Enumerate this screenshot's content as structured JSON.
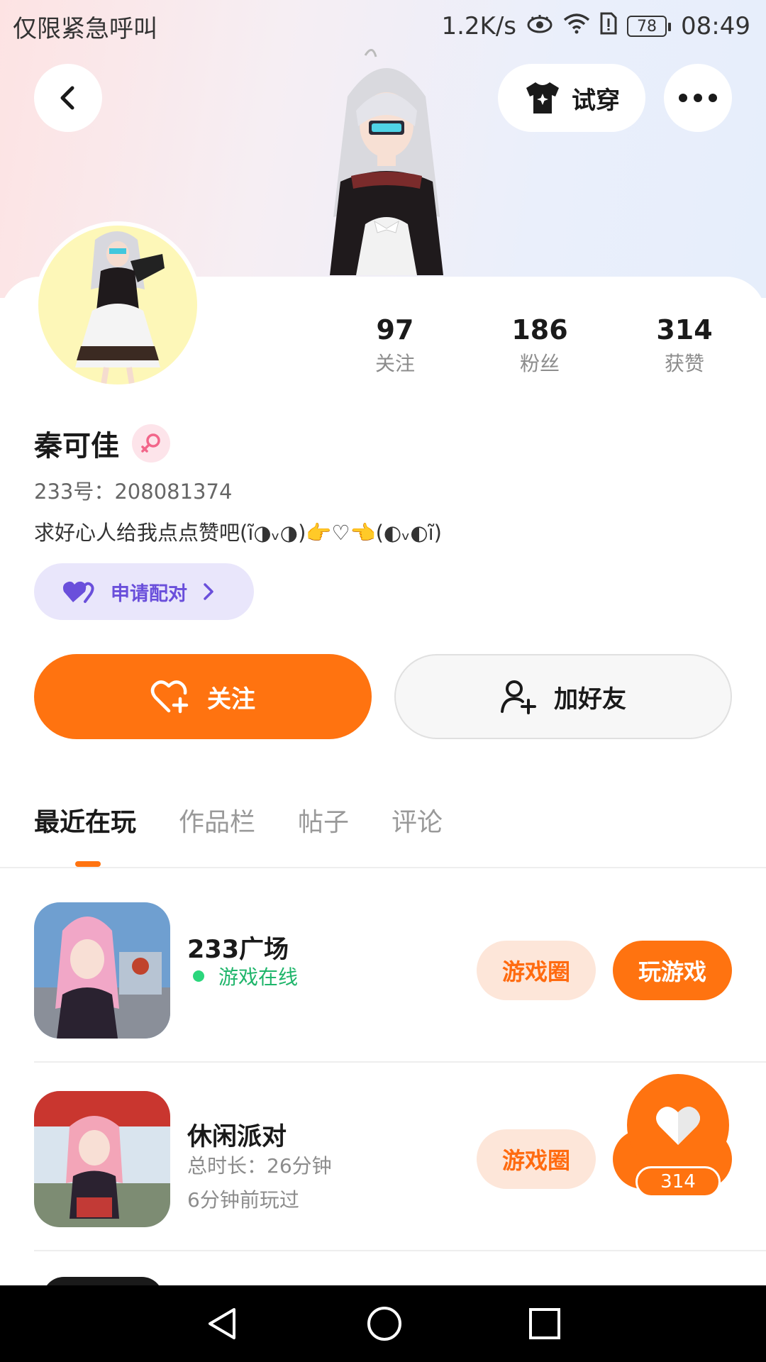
{
  "status_bar": {
    "carrier": "仅限紧急呼叫",
    "speed": "1.2K/s",
    "battery": "78",
    "time": "08:49"
  },
  "header": {
    "tryon_label": "试穿"
  },
  "stats": [
    {
      "value": "97",
      "label": "关注"
    },
    {
      "value": "186",
      "label": "粉丝"
    },
    {
      "value": "314",
      "label": "获赞"
    }
  ],
  "profile": {
    "name": "秦可佳",
    "uid": "233号：208081374",
    "bio": "求好心人给我点点赞吧(ĩ◑ᵥ◑)👉♡👈(◐ᵥ◐ĩ)",
    "pair_label": "申请配对"
  },
  "actions": {
    "follow_label": "关注",
    "add_friend_label": "加好友"
  },
  "tabs": [
    "最近在玩",
    "作品栏",
    "帖子",
    "评论"
  ],
  "games": [
    {
      "title": "233广场",
      "status": "游戏在线",
      "circle_label": "游戏圈",
      "play_label": "玩游戏"
    },
    {
      "title": "休闲派对",
      "duration": "总时长：26分钟",
      "last_played": "6分钟前玩过",
      "circle_label": "游戏圈"
    }
  ],
  "like_fab": {
    "count": "314"
  },
  "colors": {
    "accent": "#ff7310",
    "pair_purple": "#6a4fdb",
    "online_green": "#1fb56b"
  }
}
